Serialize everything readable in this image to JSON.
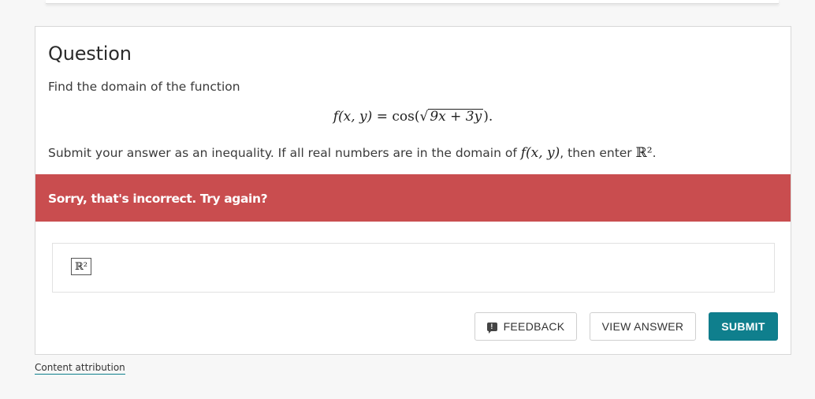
{
  "question": {
    "title": "Question",
    "prompt": "Find the domain of the function",
    "formula": {
      "lhs": "f(x, y)",
      "equals": " = cos",
      "open": "(",
      "radicand": "9x + 3y",
      "close": ").",
      "sqrt_symbol": "√"
    },
    "instruction_before": "Submit your answer as an inequality. If all real numbers are in the domain of ",
    "instruction_math": "f(x, y)",
    "instruction_middle": ", then enter ",
    "instruction_set": "ℝ²",
    "instruction_end": "."
  },
  "feedback_banner": {
    "message": "Sorry, that's incorrect. Try again?",
    "color": "#c94d4f"
  },
  "answer": {
    "value": "ℝ²"
  },
  "buttons": {
    "feedback": "FEEDBACK",
    "feedback_icon": "exclamation-comment-icon",
    "view_answer": "VIEW ANSWER",
    "submit": "SUBMIT",
    "submit_color": "#0f7f8d"
  },
  "footer": {
    "attribution": "Content attribution"
  }
}
